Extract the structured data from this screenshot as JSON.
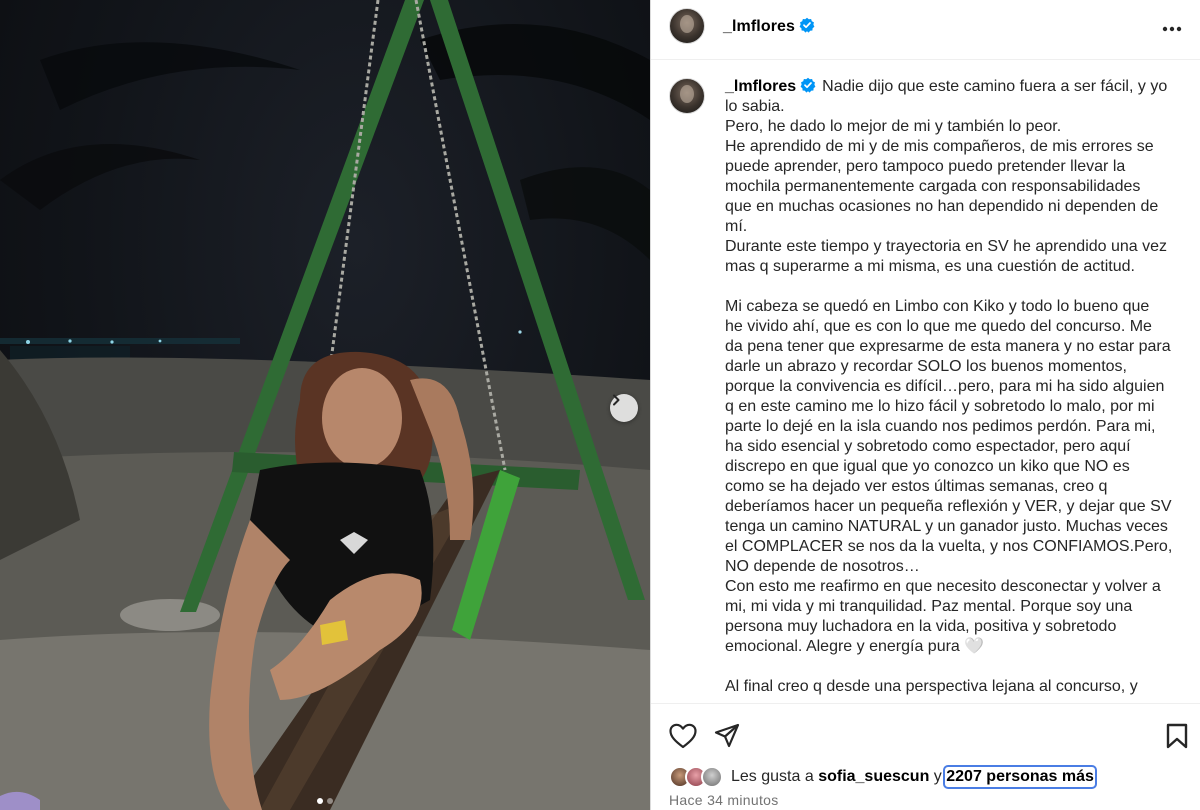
{
  "post": {
    "username": "_lmflores",
    "verified": true,
    "caption_lines": [
      "Nadie dijo que este camino fuera a ser fácil, y yo",
      "lo sabia.",
      "Pero, he dado lo mejor de mi y también lo peor.",
      "He aprendido de mi y de mis compañeros, de mis errores se",
      "puede aprender, pero tampoco puedo pretender llevar la",
      "mochila permanentemente cargada con responsabilidades",
      "que en muchas ocasiones no han dependido ni dependen de",
      "mí.",
      "Durante este tiempo y trayectoria en SV he aprendido una vez",
      "mas q superarme a mi misma, es una cuestión de actitud.",
      "",
      "Mi cabeza se quedó en Limbo con Kiko y todo lo bueno que",
      "he vivido ahí, que es con lo que me quedo del concurso. Me",
      "da pena tener que expresarme de esta manera y no estar para",
      "darle un abrazo y recordar SOLO los buenos momentos,",
      "porque la convivencia es difícil…pero, para mi ha sido alguien",
      "q en este camino me lo hizo fácil y sobretodo lo malo, por mi",
      "parte lo dejé en la isla cuando nos pedimos perdón. Para mi,",
      "ha sido esencial y sobretodo como espectador, pero aquí",
      "discrepo en que igual que yo conozco un kiko que NO es",
      "como se ha dejado ver estos últimas semanas, creo q",
      "deberíamos hacer un pequeña reflexión y VER, y dejar que SV",
      "tenga un camino NATURAL y un ganador justo. Muchas veces",
      "el COMPLACER se nos da la vuelta, y nos CONFIAMOS.Pero,",
      "NO depende de nosotros…",
      "Con esto me reafirmo en que necesito desconectar y volver a",
      "mi, mi vida y mi tranquilidad. Paz mental. Porque soy una",
      "persona muy luchadora en la vida, positiva y sobretodo",
      "emocional. Alegre y energía pura 🤍",
      "",
      "Al final creo q desde una perspectiva lejana al concurso, y"
    ],
    "likes": {
      "prefix": "Les gusta a",
      "user": "sofia_suescun",
      "connector": "y",
      "count_text": "2207 personas más"
    },
    "timestamp": "Hace 34 minutos",
    "carousel": {
      "total": 2,
      "current": 1
    }
  },
  "icons": {
    "more": "more-options-icon",
    "next": "chevron-right-icon",
    "like": "heart-icon",
    "share": "paper-plane-icon",
    "save": "bookmark-icon",
    "verified": "verified-badge-icon"
  },
  "colors": {
    "verified_blue": "#0095f6",
    "swing_green": "#2f6b34",
    "secondary_text": "#737373"
  }
}
